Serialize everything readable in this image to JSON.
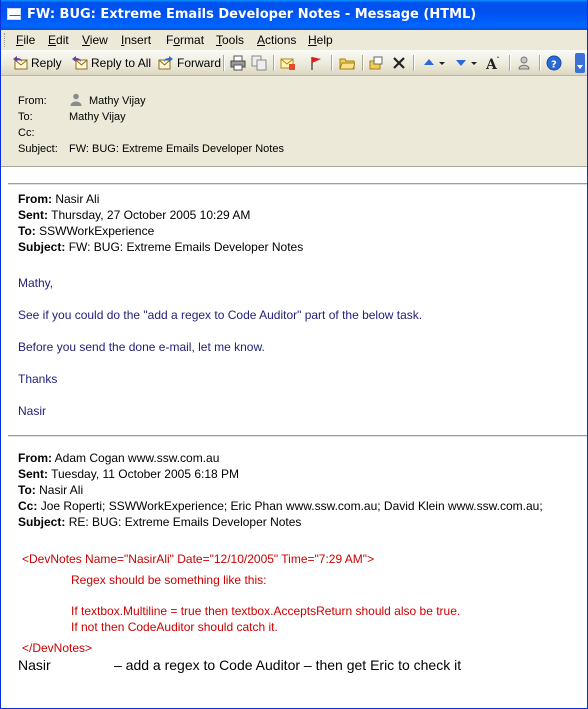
{
  "window": {
    "title": "FW: BUG: Extreme Emails Developer Notes - Message (HTML)"
  },
  "menu": [
    {
      "label": "File",
      "key": "F"
    },
    {
      "label": "Edit",
      "key": "E"
    },
    {
      "label": "View",
      "key": "V"
    },
    {
      "label": "Insert",
      "key": "I"
    },
    {
      "label": "Format",
      "key": "o"
    },
    {
      "label": "Tools",
      "key": "T"
    },
    {
      "label": "Actions",
      "key": "A"
    },
    {
      "label": "Help",
      "key": "H"
    }
  ],
  "toolbar": {
    "reply_label": "Reply",
    "reply_all_label": "Reply to All",
    "forward_label": "Forward"
  },
  "header": {
    "from_label": "From:",
    "from_value": "Mathy Vijay",
    "to_label": "To:",
    "to_value": "Mathy Vijay",
    "cc_label": "Cc:",
    "cc_value": "",
    "subject_label": "Subject:",
    "subject_value": "FW: BUG: Extreme Emails Developer Notes"
  },
  "message1": {
    "from_label": "From:",
    "from_value": "Nasir Ali",
    "sent_label": "Sent:",
    "sent_value": "Thursday, 27 October 2005 10:29 AM",
    "to_label": "To:",
    "to_value": "SSWWorkExperience",
    "subject_label": "Subject:",
    "subject_value": "FW: BUG: Extreme Emails Developer Notes",
    "body": [
      "Mathy,",
      "See if you could do the \"add a regex to Code Auditor\" part of the below task.",
      "Before you send the done e-mail, let me know.",
      "Thanks",
      "Nasir"
    ]
  },
  "message2": {
    "from_label": "From:",
    "from_value": "Adam Cogan www.ssw.com.au",
    "sent_label": "Sent:",
    "sent_value": "Tuesday, 11 October 2005 6:18 PM",
    "to_label": "To:",
    "to_value": "Nasir Ali",
    "cc_label": "Cc:",
    "cc_value": "Joe Roperti; SSWWorkExperience; Eric Phan www.ssw.com.au; David Klein www.ssw.com.au;",
    "subject_label": "Subject:",
    "subject_value": "RE: BUG: Extreme Emails Developer Notes",
    "devnotes_open": "<DevNotes Name=\"NasirAli\" Date=\"12/10/2005\" Time=\"7:29 AM\">",
    "devnotes_line1": "Regex should be something like this:",
    "devnotes_line2": "If textbox.Multiline = true then textbox.AcceptsReturn should also be true.",
    "devnotes_line3": "If not then CodeAuditor should catch it.",
    "devnotes_close": "</DevNotes>",
    "task_name": "Nasir",
    "task_text": "– add a regex to Code Auditor – then get Eric to check it"
  },
  "colors": {
    "title_bar": "#0054e3",
    "chrome": "#ece9d8",
    "body_text_blue": "#1f1f7a",
    "devnotes_red": "#cc0000"
  }
}
